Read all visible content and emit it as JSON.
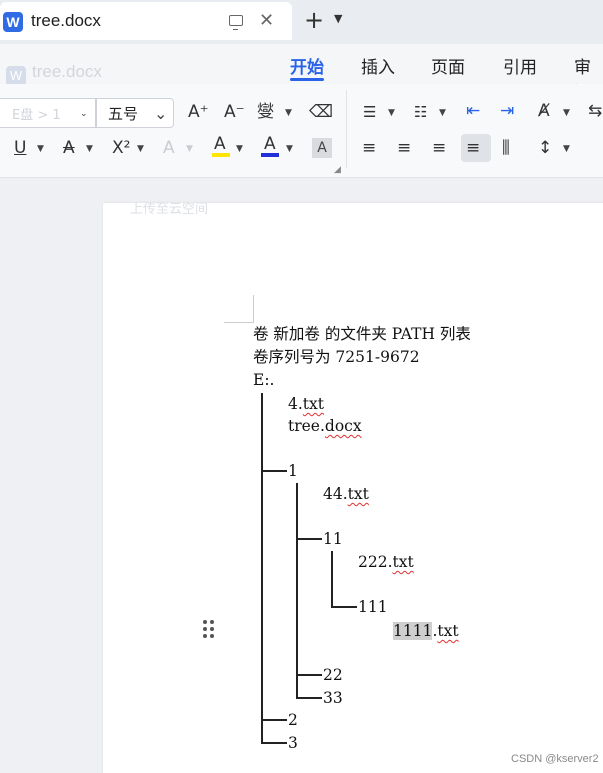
{
  "window": {
    "tab_title": "tree.docx",
    "logo_letter": "W",
    "close_glyph": "✕",
    "new_tab_glyph": "+"
  },
  "ghost": {
    "title": "tree.docx",
    "logo_letter": "W"
  },
  "ribbon": {
    "tabs": [
      {
        "label": "开始",
        "active": true
      },
      {
        "label": "插入"
      },
      {
        "label": "页面"
      },
      {
        "label": "引用"
      },
      {
        "label": "审阅"
      }
    ]
  },
  "toolbar": {
    "font_name_ghost": "E盘 > 1",
    "font_size": "五号",
    "grow_font": "A⁺",
    "shrink_font": "A⁻",
    "phonetic": "燮",
    "underline": "U",
    "strikethrough": "A",
    "superscript": "X²",
    "text_effect": "A",
    "highlight": "A",
    "font_color": "A",
    "char_shading": "A"
  },
  "colors": {
    "accent": "#2a63e8",
    "highlight": "#ffe600",
    "font_color": "#2030d8",
    "logo": "#2f6be5"
  },
  "page": {
    "upload_ghost": "上传至云空间"
  },
  "document": {
    "lines": [
      "卷 新加卷 的文件夹 PATH 列表",
      "卷序列号为 7251-9672",
      "E:."
    ],
    "files": {
      "f4": "4.",
      "f4_ext": "txt",
      "tree": "tree.",
      "tree_ext": "docx",
      "d1": "1",
      "f44": "44.",
      "f44_ext": "txt",
      "d11": "11",
      "f222": "222.",
      "f222_ext": "txt",
      "d111": "111",
      "f1111": "1111",
      "f1111_dot": ".",
      "f1111_ext": "txt",
      "d22": "22",
      "d33": "33",
      "d2": "2",
      "d3": "3"
    }
  },
  "watermark": "CSDN @kserver2"
}
